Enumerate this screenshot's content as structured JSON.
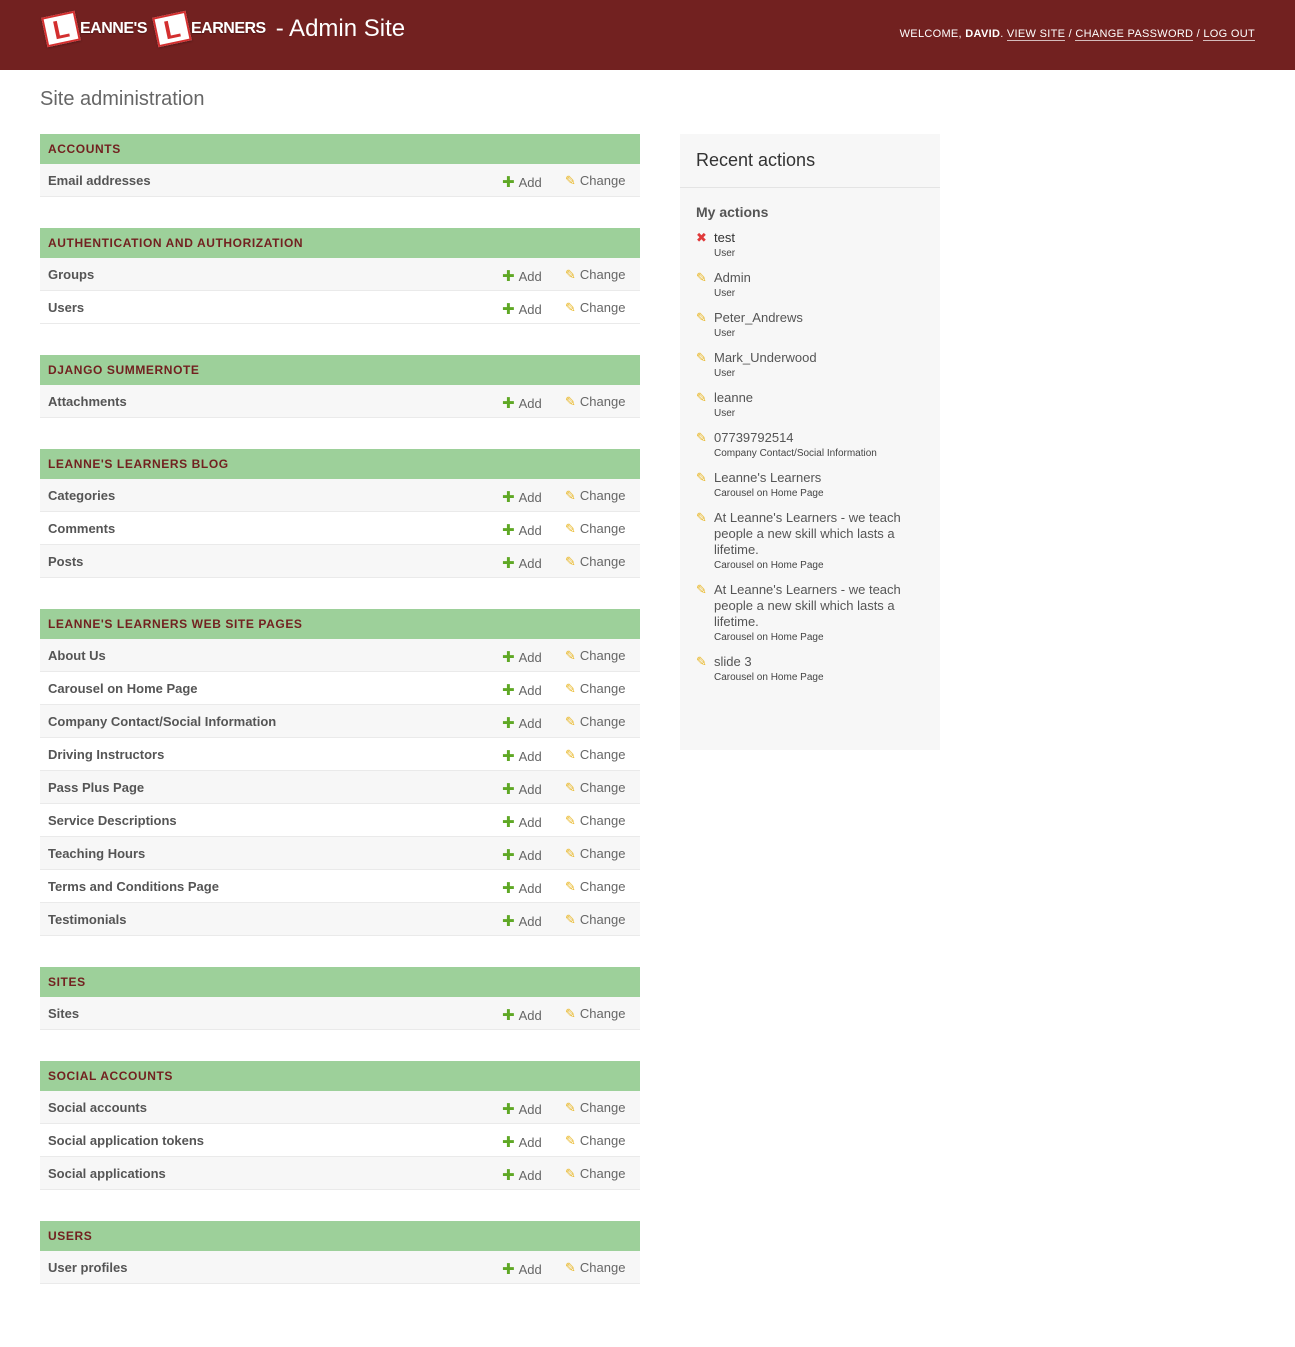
{
  "header": {
    "logo_word1": "EANNE'S",
    "logo_word2": "EARNERS",
    "logo_letter": "L",
    "site_title": "- Admin Site",
    "welcome": "WELCOME,",
    "username": "DAVID",
    "view_site": "VIEW SITE",
    "change_password": "CHANGE PASSWORD",
    "log_out": "LOG OUT",
    "sep": "/"
  },
  "page_title": "Site administration",
  "labels": {
    "add": "Add",
    "change": "Change"
  },
  "modules": [
    {
      "caption": "ACCOUNTS",
      "models": [
        "Email addresses"
      ]
    },
    {
      "caption": "AUTHENTICATION AND AUTHORIZATION",
      "models": [
        "Groups",
        "Users"
      ]
    },
    {
      "caption": "DJANGO SUMMERNOTE",
      "models": [
        "Attachments"
      ]
    },
    {
      "caption": "LEANNE'S LEARNERS BLOG",
      "models": [
        "Categories",
        "Comments",
        "Posts"
      ]
    },
    {
      "caption": "LEANNE'S LEARNERS WEB SITE PAGES",
      "models": [
        "About Us",
        "Carousel on Home Page",
        "Company Contact/Social Information",
        "Driving Instructors",
        "Pass Plus Page",
        "Service Descriptions",
        "Teaching Hours",
        "Terms and Conditions Page",
        "Testimonials"
      ]
    },
    {
      "caption": "SITES",
      "models": [
        "Sites"
      ]
    },
    {
      "caption": "SOCIAL ACCOUNTS",
      "models": [
        "Social accounts",
        "Social application tokens",
        "Social applications"
      ]
    },
    {
      "caption": "USERS",
      "models": [
        "User profiles"
      ]
    }
  ],
  "sidebar": {
    "title": "Recent actions",
    "subtitle": "My actions",
    "actions": [
      {
        "icon": "delete-icon",
        "title": "test",
        "type": "User"
      },
      {
        "icon": "pencil-icon",
        "title": "Admin",
        "type": "User"
      },
      {
        "icon": "pencil-icon",
        "title": "Peter_Andrews",
        "type": "User"
      },
      {
        "icon": "pencil-icon",
        "title": "Mark_Underwood",
        "type": "User"
      },
      {
        "icon": "pencil-icon",
        "title": "leanne",
        "type": "User"
      },
      {
        "icon": "pencil-icon",
        "title": "07739792514",
        "type": "Company Contact/Social Information"
      },
      {
        "icon": "pencil-icon",
        "title": "Leanne's Learners",
        "type": "Carousel on Home Page"
      },
      {
        "icon": "pencil-icon",
        "title": "At Leanne's Learners - we teach people a new skill which lasts a lifetime.",
        "type": "Carousel on Home Page"
      },
      {
        "icon": "pencil-icon",
        "title": "At Leanne's Learners - we teach people a new skill which lasts a lifetime.",
        "type": "Carousel on Home Page"
      },
      {
        "icon": "pencil-icon",
        "title": "slide 3",
        "type": "Carousel on Home Page"
      }
    ]
  },
  "colors": {
    "header": "#722120",
    "caption_bg": "#9dd09a",
    "caption_text": "#722120",
    "add": "#5fa825",
    "change": "#e8b41c",
    "delete": "#e03a3a"
  }
}
